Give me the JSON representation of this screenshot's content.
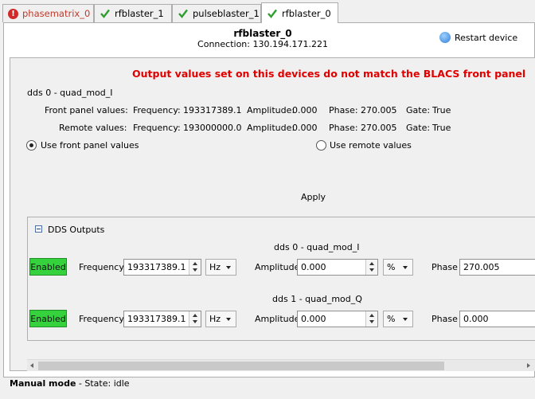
{
  "tabs": [
    {
      "label": "phasematrix_0",
      "state": "error",
      "icon": "error-icon"
    },
    {
      "label": "rfblaster_1",
      "state": "ok",
      "icon": "checkmark-icon"
    },
    {
      "label": "pulseblaster_1",
      "state": "ok",
      "icon": "checkmark-icon"
    },
    {
      "label": "rfblaster_0",
      "state": "ok",
      "icon": "checkmark-icon"
    }
  ],
  "device": {
    "name": "rfblaster_0",
    "connection": "Connection: 130.194.171.221",
    "restart_label": "Restart device"
  },
  "warning": {
    "message": "Output values set on this devices do not match the BLACS front panel",
    "channel": "dds 0 - quad_mod_I",
    "front_panel": {
      "label": "Front panel values:",
      "frequency_label": "Frequency:",
      "frequency": "193317389.1",
      "amplitude_label": "Amplitude:",
      "amplitude": "0.000",
      "phase_label": "Phase:",
      "phase": "270.005",
      "gate_label": "Gate:",
      "gate": "True"
    },
    "remote": {
      "label": "Remote values:",
      "frequency_label": "Frequency:",
      "frequency": "193000000.0",
      "amplitude_label": "Amplitude:",
      "amplitude": "0.000",
      "phase_label": "Phase:",
      "phase": "270.005",
      "gate_label": "Gate:",
      "gate": "True"
    },
    "use_front_label": "Use front panel values",
    "use_remote_label": "Use remote values",
    "apply_label": "Apply"
  },
  "dds_outputs": {
    "title": "DDS Outputs",
    "channels": [
      {
        "name": "dds 0 - quad_mod_I",
        "enabled_label": "Enabled",
        "frequency_label": "Frequency",
        "frequency": "193317389.1",
        "frequency_unit": "Hz",
        "amplitude_label": "Amplitude",
        "amplitude": "0.000",
        "amplitude_unit": "%",
        "phase_label": "Phase",
        "phase": "270.005"
      },
      {
        "name": "dds 1 - quad_mod_Q",
        "enabled_label": "Enabled",
        "frequency_label": "Frequency",
        "frequency": "193317389.1",
        "frequency_unit": "Hz",
        "amplitude_label": "Amplitude",
        "amplitude": "0.000",
        "amplitude_unit": "%",
        "phase_label": "Phase",
        "phase": "0.000"
      }
    ]
  },
  "status": {
    "mode": "Manual mode",
    "state": " - State: idle"
  },
  "colors": {
    "warning": "#e00000",
    "enabled": "#35d23e",
    "error": "#d12a2a",
    "ok": "#2e9e2e"
  }
}
